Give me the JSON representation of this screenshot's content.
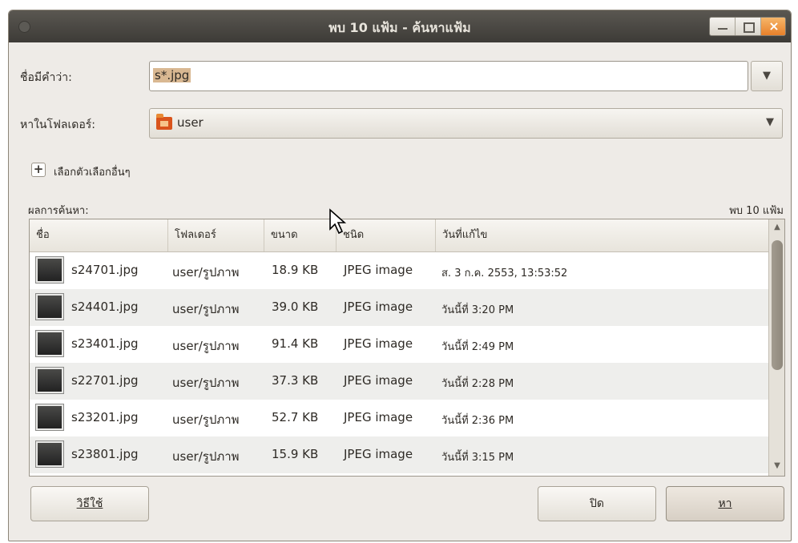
{
  "window": {
    "title": "พบ 10 แฟ้ม - ค้นหาแฟ้ม",
    "controls": {
      "minimize_icon": "minimize-icon",
      "maximize_icon": "maximize-icon",
      "close_icon": "close-icon",
      "close_glyph": "×"
    }
  },
  "form": {
    "name_label": "ชื่อมีคำว่า:",
    "name_value": "s*.jpg",
    "name_dropdown_glyph": "▼",
    "folder_label": "หาในโฟลเดอร์:",
    "folder_value": "user",
    "folder_dropdown_glyph": "▼",
    "more_options_glyph": "+",
    "more_options_label": "เลือกตัวเลือกอื่นๆ"
  },
  "results": {
    "label": "ผลการค้นหา:",
    "count": "พบ 10 แฟ้ม",
    "columns": [
      "ชื่อ",
      "โฟลเดอร์",
      "ขนาด",
      "ชนิด",
      "วันที่แก้ไข"
    ],
    "rows": [
      {
        "name": "s24701.jpg",
        "folder": "user/รูปภาพ",
        "size": "18.9 KB",
        "type": "JPEG image",
        "modified": "ส. 3 ก.ค. 2553, 13:53:52"
      },
      {
        "name": "s24401.jpg",
        "folder": "user/รูปภาพ",
        "size": "39.0 KB",
        "type": "JPEG image",
        "modified": "วันนี้ที่ 3:20 PM"
      },
      {
        "name": "s23401.jpg",
        "folder": "user/รูปภาพ",
        "size": "91.4 KB",
        "type": "JPEG image",
        "modified": "วันนี้ที่ 2:49 PM"
      },
      {
        "name": "s22701.jpg",
        "folder": "user/รูปภาพ",
        "size": "37.3 KB",
        "type": "JPEG image",
        "modified": "วันนี้ที่ 2:28 PM"
      },
      {
        "name": "s23201.jpg",
        "folder": "user/รูปภาพ",
        "size": "52.7 KB",
        "type": "JPEG image",
        "modified": "วันนี้ที่ 2:36 PM"
      },
      {
        "name": "s23801.jpg",
        "folder": "user/รูปภาพ",
        "size": "15.9 KB",
        "type": "JPEG image",
        "modified": "วันนี้ที่ 3:15 PM"
      }
    ],
    "scroll_up_glyph": "▲",
    "scroll_down_glyph": "▼"
  },
  "buttons": {
    "help": "วิธีใช้",
    "close": "ปิด",
    "find": "หา"
  },
  "colors": {
    "titlebar": "#3d3b37",
    "window_bg": "#eeebe7",
    "selection": "#d9b892",
    "close_button": "#e8802a",
    "folder_icon": "#d9541c"
  }
}
